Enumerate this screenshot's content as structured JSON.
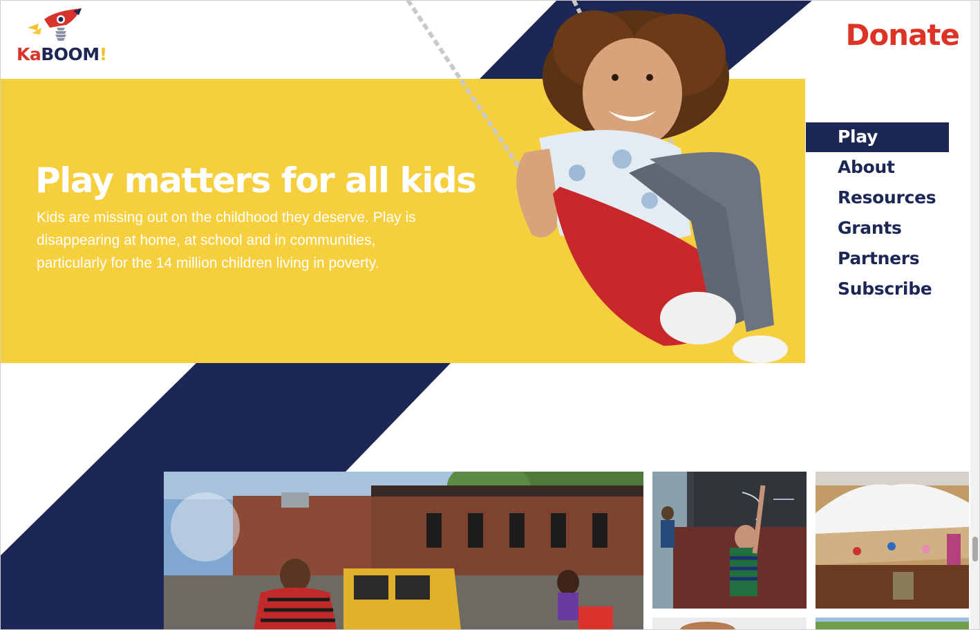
{
  "brand": {
    "logo": {
      "ka": "Ka",
      "boom": "BOOM",
      "bang": "!"
    },
    "colors": {
      "navy": "#1c2756",
      "yellow": "#f6cf3f",
      "red": "#dd3326",
      "white": "#ffffff"
    }
  },
  "header": {
    "donate_label": "Donate"
  },
  "nav": {
    "items": [
      {
        "label": "Play",
        "active": true
      },
      {
        "label": "About"
      },
      {
        "label": "Resources"
      },
      {
        "label": "Grants"
      },
      {
        "label": "Partners"
      },
      {
        "label": "Subscribe"
      }
    ]
  },
  "hero": {
    "title": "Play matters for all kids",
    "body": "Kids are missing out on the childhood they deserve. Play is disappearing at home, at school and in communities, particularly for the 14 million children living in poverty."
  },
  "icons": {
    "logo": "rocket-logo-icon"
  }
}
